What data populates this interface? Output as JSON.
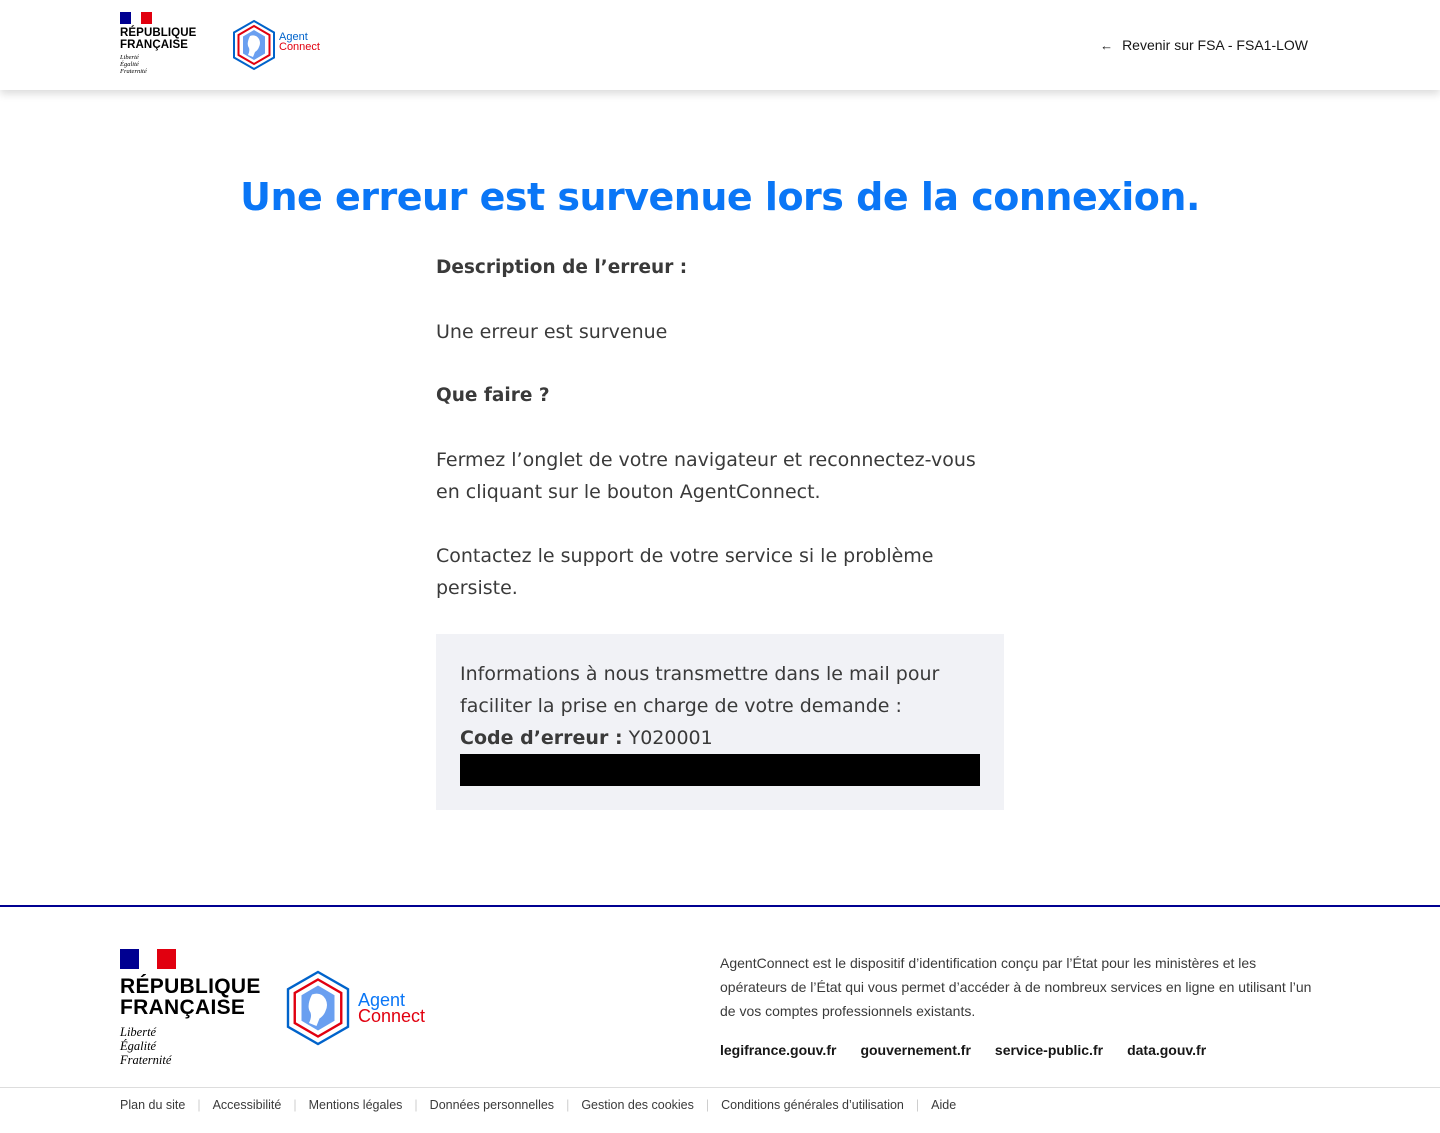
{
  "header": {
    "brand": {
      "line1": "RÉPUBLIQUE",
      "line2": "FRANÇAISE",
      "motto": [
        "Liberté",
        "Égalité",
        "Fraternité"
      ]
    },
    "agentconnect": {
      "line1": "Agent",
      "line2": "Connect"
    },
    "back_link_label": "Revenir sur FSA - FSA1-LOW",
    "back_link_icon": "arrow-left-icon"
  },
  "main": {
    "title": "Une erreur est survenue lors de la connexion.",
    "description_heading": "Description de l’erreur :",
    "description_text": "Une erreur est survenue",
    "action_heading": "Que faire ?",
    "action_text_1": "Fermez l’onglet de votre navigateur et reconnectez-vous en cliquant sur le bouton AgentConnect.",
    "action_text_2": "Contactez le support de votre service si le problème persiste.",
    "info_box": {
      "text": "Informations à nous transmettre dans le mail pour faciliter la prise en charge de votre demande :",
      "code_label": "Code d’erreur :",
      "code_value": " Y020001"
    }
  },
  "footer": {
    "brand": {
      "line1": "RÉPUBLIQUE",
      "line2": "FRANÇAISE",
      "motto": [
        "Liberté",
        "Égalité",
        "Fraternité"
      ]
    },
    "agentconnect": {
      "line1": "Agent",
      "line2": "Connect"
    },
    "description": "AgentConnect est le dispositif d’identification conçu par l’État pour les ministères et les opérateurs de l’État qui vous permet d’accéder à de nombreux services en ligne en utilisant l’un de vos comptes professionnels existants.",
    "links": [
      "legifrance.gouv.fr",
      "gouvernement.fr",
      "service-public.fr",
      "data.gouv.fr"
    ],
    "bottom_links": [
      "Plan du site",
      "Accessibilité",
      "Mentions légales",
      "Données personnelles",
      "Gestion des cookies",
      "Conditions générales d’utilisation",
      "Aide"
    ]
  },
  "colors": {
    "title_blue": "#0a76f6",
    "france_blue": "#000091",
    "france_red": "#e1000f",
    "info_box_bg": "#f1f2f6"
  }
}
